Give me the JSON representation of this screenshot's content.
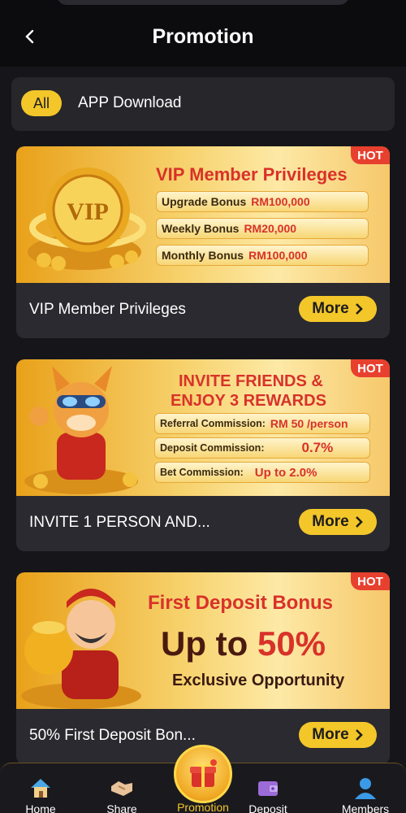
{
  "header": {
    "title": "Promotion"
  },
  "filters": {
    "all_label": "All",
    "app_label": "APP Download"
  },
  "cards": [
    {
      "hot": "HOT",
      "banner_title": "VIP Member Privileges",
      "rows": [
        {
          "label": "Upgrade Bonus",
          "value": "RM100,000"
        },
        {
          "label": "Weekly Bonus",
          "value": "RM20,000"
        },
        {
          "label": "Monthly Bonus",
          "value": "RM100,000"
        }
      ],
      "badge_text": "VIP",
      "caption": "VIP Member Privileges",
      "more": "More"
    },
    {
      "hot": "HOT",
      "banner_title_1": "INVITE FRIENDS &",
      "banner_title_2": "ENJOY 3 REWARDS",
      "rows": [
        {
          "label": "Referral Commission:",
          "value": "RM 50 /person"
        },
        {
          "label": "Deposit Commission:",
          "value": "0.7%"
        },
        {
          "label": "Bet Commission:",
          "value": "Up to 2.0%"
        }
      ],
      "caption": "INVITE 1 PERSON AND...",
      "more": "More"
    },
    {
      "hot": "HOT",
      "banner_title": "First Deposit Bonus",
      "big_text_1": "Up to",
      "big_text_2": "50%",
      "sub_text": "Exclusive Opportunity",
      "caption": "50% First Deposit Bon...",
      "more": "More"
    }
  ],
  "nav": [
    {
      "label": "Home",
      "icon": "home-icon"
    },
    {
      "label": "Share",
      "icon": "handshake-icon"
    },
    {
      "label": "Promotion",
      "icon": "gift-icon"
    },
    {
      "label": "Deposit",
      "icon": "wallet-icon"
    },
    {
      "label": "Members",
      "icon": "user-icon"
    }
  ],
  "colors": {
    "accent": "#f3c62a",
    "hot": "#e8402e",
    "card_bg": "#2a2a30",
    "bg": "#16161a"
  }
}
